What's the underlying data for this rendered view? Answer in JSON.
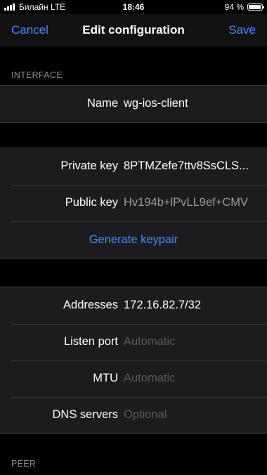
{
  "status_bar": {
    "carrier": "Билайн LTE",
    "time": "18:46",
    "battery": "94 %",
    "battery_level": 0.94
  },
  "nav": {
    "cancel": "Cancel",
    "title": "Edit configuration",
    "save": "Save"
  },
  "interface": {
    "header": "INTERFACE",
    "name_label": "Name",
    "name_value": "wg-ios-client",
    "private_key_label": "Private key",
    "private_key_value": "8PTMZefe7ttv8SsCLS...",
    "public_key_label": "Public key",
    "public_key_value": "Hv194b+lPvLL9ef+CMV",
    "generate_keypair": "Generate keypair",
    "addresses_label": "Addresses",
    "addresses_value": "172.16.82.7/32",
    "listen_port_label": "Listen port",
    "listen_port_placeholder": "Automatic",
    "mtu_label": "MTU",
    "mtu_placeholder": "Automatic",
    "dns_label": "DNS servers",
    "dns_placeholder": "Optional"
  },
  "peer": {
    "header": "PEER"
  },
  "colors": {
    "accent": "#3d8ef7",
    "background": "#000000",
    "cell": "#1c1c1e"
  }
}
